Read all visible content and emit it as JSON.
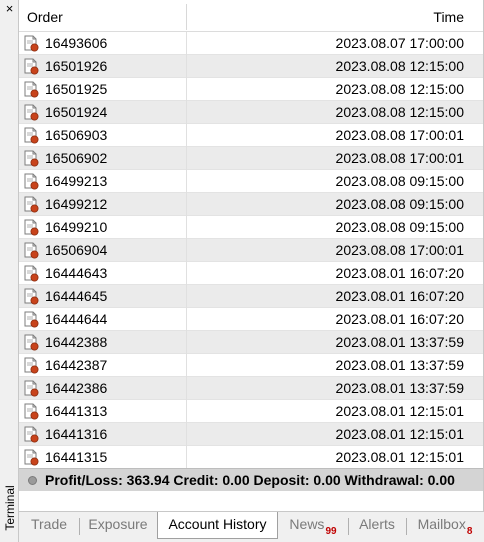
{
  "window": {
    "side_title": "Terminal",
    "close_glyph": "×"
  },
  "table": {
    "headers": {
      "order": "Order",
      "time": "Time"
    },
    "rows": [
      {
        "order": "16493606",
        "time": "2023.08.07 17:00:00"
      },
      {
        "order": "16501926",
        "time": "2023.08.08 12:15:00"
      },
      {
        "order": "16501925",
        "time": "2023.08.08 12:15:00"
      },
      {
        "order": "16501924",
        "time": "2023.08.08 12:15:00"
      },
      {
        "order": "16506903",
        "time": "2023.08.08 17:00:01"
      },
      {
        "order": "16506902",
        "time": "2023.08.08 17:00:01"
      },
      {
        "order": "16499213",
        "time": "2023.08.08 09:15:00"
      },
      {
        "order": "16499212",
        "time": "2023.08.08 09:15:00"
      },
      {
        "order": "16499210",
        "time": "2023.08.08 09:15:00"
      },
      {
        "order": "16506904",
        "time": "2023.08.08 17:00:01"
      },
      {
        "order": "16444643",
        "time": "2023.08.01 16:07:20"
      },
      {
        "order": "16444645",
        "time": "2023.08.01 16:07:20"
      },
      {
        "order": "16444644",
        "time": "2023.08.01 16:07:20"
      },
      {
        "order": "16442388",
        "time": "2023.08.01 13:37:59"
      },
      {
        "order": "16442387",
        "time": "2023.08.01 13:37:59"
      },
      {
        "order": "16442386",
        "time": "2023.08.01 13:37:59"
      },
      {
        "order": "16441313",
        "time": "2023.08.01 12:15:01"
      },
      {
        "order": "16441316",
        "time": "2023.08.01 12:15:01"
      },
      {
        "order": "16441315",
        "time": "2023.08.01 12:15:01"
      }
    ],
    "row_icon": "closed-order-document-icon",
    "summary": "Profit/Loss: 363.94  Credit: 0.00  Deposit: 0.00  Withdrawal: 0.00"
  },
  "tabs": [
    {
      "label": "Trade",
      "badge": ""
    },
    {
      "label": "Exposure",
      "badge": ""
    },
    {
      "label": "Account History",
      "badge": "",
      "active": true
    },
    {
      "label": "News",
      "badge": "99"
    },
    {
      "label": "Alerts",
      "badge": ""
    },
    {
      "label": "Mailbox",
      "badge": "8"
    }
  ],
  "colors": {
    "alt_row": "#ebebeb",
    "summary_bg": "#d4d4d4",
    "badge": "#c00000",
    "icon_dot": "#c8431b"
  }
}
